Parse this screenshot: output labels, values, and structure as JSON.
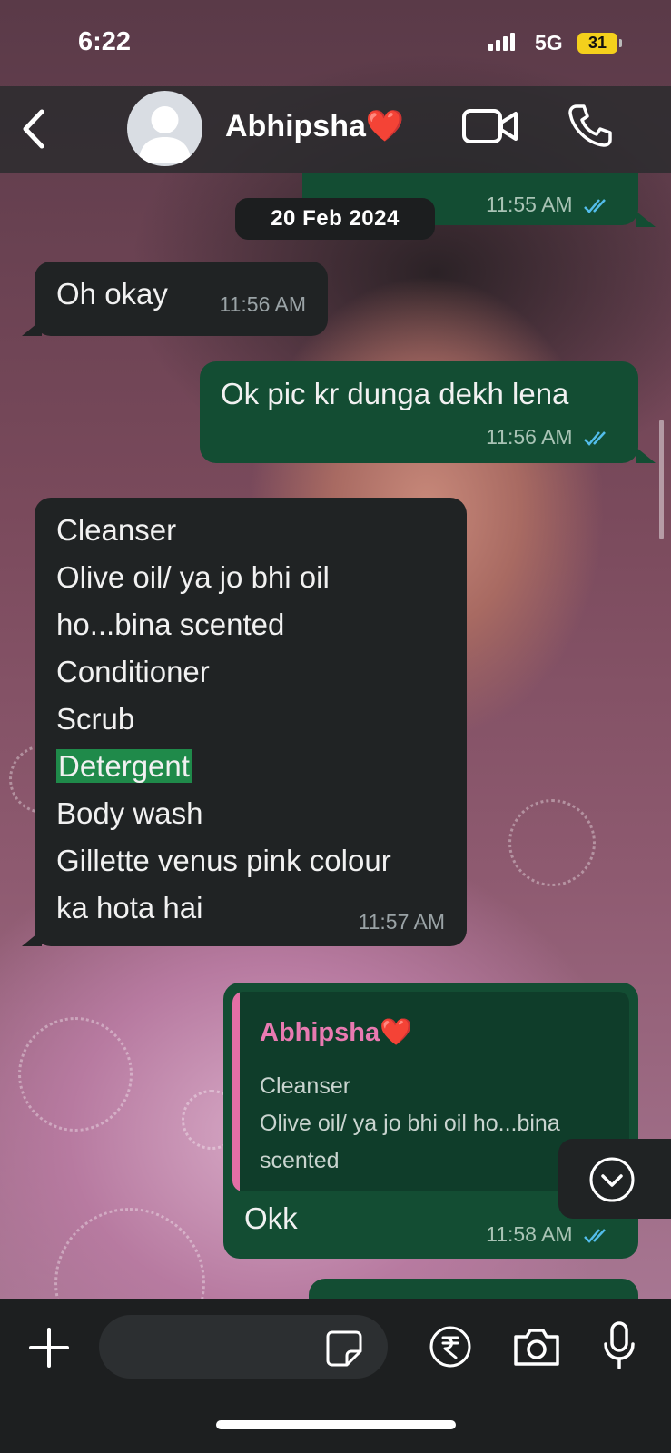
{
  "status_bar": {
    "time": "6:22",
    "network": "5G",
    "battery": "31"
  },
  "header": {
    "contact_name": "Abhipsha❤️"
  },
  "messages": [
    {
      "direction": "outgoing",
      "time": "11:55 AM",
      "read": true
    },
    {
      "type": "date",
      "text": "20 Feb 2024"
    },
    {
      "direction": "incoming",
      "text": "Oh okay",
      "time": "11:56 AM"
    },
    {
      "direction": "outgoing",
      "text": "Ok pic kr dunga dekh lena",
      "time": "11:56 AM",
      "read": true
    },
    {
      "direction": "incoming",
      "lines": [
        "Cleanser",
        "Olive oil/ ya jo bhi oil",
        "ho...bina scented",
        "Conditioner",
        "Scrub",
        "Detergent",
        "Body wash",
        "Gillette venus pink colour",
        "ka hota hai"
      ],
      "highlighted": "Detergent",
      "time": "11:57 AM"
    },
    {
      "direction": "outgoing",
      "reply_to": {
        "author": "Abhipsha❤️",
        "lines": [
          "Cleanser",
          "Olive oil/ ya jo bhi oil ho...bina",
          "scented"
        ]
      },
      "text": "Okk",
      "time": "11:58 AM",
      "read": true
    }
  ],
  "icons": {
    "back": "chevron-left-icon",
    "avatar": "person-icon",
    "video": "video-camera-icon",
    "call": "phone-icon",
    "ticks": "double-check-icon",
    "scroll": "chevron-down-circle-icon",
    "plus": "plus-icon",
    "sticker": "sticker-icon",
    "rupee": "rupee-icon",
    "camera": "camera-icon",
    "mic": "microphone-icon"
  },
  "colors": {
    "incoming_bubble": "#202324",
    "outgoing_bubble": "#134d33",
    "read_ticks": "#53bdeb",
    "highlight": "#1f8a4a",
    "quote_accent": "#e26fa5"
  }
}
